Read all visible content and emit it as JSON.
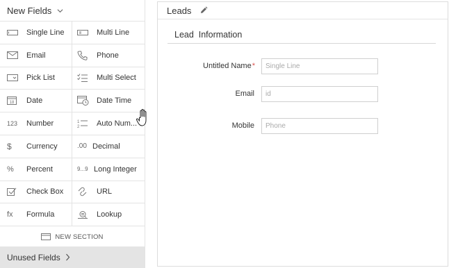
{
  "palette": {
    "title": "New Fields",
    "fields": [
      {
        "label": "Single Line",
        "icon": "single-line-icon"
      },
      {
        "label": "Multi Line",
        "icon": "multi-line-icon"
      },
      {
        "label": "Email",
        "icon": "email-icon"
      },
      {
        "label": "Phone",
        "icon": "phone-icon"
      },
      {
        "label": "Pick List",
        "icon": "picklist-icon"
      },
      {
        "label": "Multi Select",
        "icon": "multi-select-icon"
      },
      {
        "label": "Date",
        "icon": "date-icon",
        "icon_text": "18"
      },
      {
        "label": "Date Time",
        "icon": "date-time-icon"
      },
      {
        "label": "Number",
        "icon": "number-icon",
        "icon_text": "123"
      },
      {
        "label": "Auto Num...",
        "icon": "auto-number-icon"
      },
      {
        "label": "Currency",
        "icon": "currency-icon",
        "icon_text": "$"
      },
      {
        "label": "Decimal",
        "icon": "decimal-icon",
        "icon_text": ".00"
      },
      {
        "label": "Percent",
        "icon": "percent-icon",
        "icon_text": "%"
      },
      {
        "label": "Long Integer",
        "icon": "long-integer-icon",
        "icon_text": "9...9"
      },
      {
        "label": "Check Box",
        "icon": "checkbox-icon"
      },
      {
        "label": "URL",
        "icon": "url-icon"
      },
      {
        "label": "Formula",
        "icon": "formula-icon",
        "icon_text": "fx"
      },
      {
        "label": "Lookup",
        "icon": "lookup-icon"
      }
    ],
    "new_section": "NEW SECTION",
    "unused": "Unused Fields"
  },
  "form": {
    "module": "Leads",
    "section_title": "Lead  Information",
    "fields": [
      {
        "label": "Untitled Name",
        "required": "*",
        "placeholder": "Single Line"
      },
      {
        "label": "Email",
        "required": "",
        "placeholder": "id"
      },
      {
        "label": "Mobile",
        "required": "",
        "placeholder": "Phone"
      }
    ]
  }
}
